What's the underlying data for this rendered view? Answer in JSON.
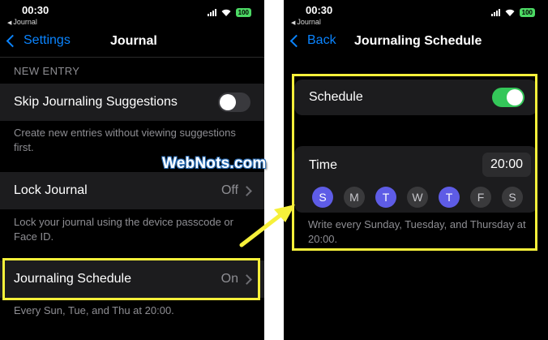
{
  "colors": {
    "accent_blue": "#0a84ff",
    "toggle_on": "#34c759",
    "day_active": "#5e5ce6",
    "highlight": "#f6f03a",
    "battery": "#4cd964"
  },
  "left": {
    "status": {
      "time": "00:30",
      "back_app": "Journal",
      "battery": "100"
    },
    "nav": {
      "back_label": "Settings",
      "title": "Journal"
    },
    "section_header": "NEW ENTRY",
    "skip_row": {
      "label": "Skip Journaling Suggestions",
      "toggle_state": "off"
    },
    "skip_footer": "Create new entries without viewing suggestions first.",
    "lock_row": {
      "label": "Lock Journal",
      "value": "Off"
    },
    "lock_footer": "Lock your journal using the device passcode or Face ID.",
    "schedule_row": {
      "label": "Journaling Schedule",
      "value": "On"
    },
    "schedule_footer": "Every Sun, Tue, and Thu at 20:00."
  },
  "right": {
    "status": {
      "time": "00:30",
      "back_app": "Journal",
      "battery": "100"
    },
    "nav": {
      "back_label": "Back",
      "title": "Journaling Schedule"
    },
    "schedule_row": {
      "label": "Schedule",
      "toggle_state": "on"
    },
    "time_row": {
      "label": "Time",
      "value": "20:00"
    },
    "days": [
      {
        "letter": "S",
        "active": true
      },
      {
        "letter": "M",
        "active": false
      },
      {
        "letter": "T",
        "active": true
      },
      {
        "letter": "W",
        "active": false
      },
      {
        "letter": "T",
        "active": true
      },
      {
        "letter": "F",
        "active": false
      },
      {
        "letter": "S",
        "active": false
      }
    ],
    "footer": "Write every Sunday, Tuesday, and Thursday at 20:00."
  },
  "watermark": "WebNots.com",
  "icons": [
    "signal-icon",
    "wifi-icon",
    "battery-icon",
    "chevron-left-icon",
    "chevron-right-icon",
    "arrow-icon"
  ]
}
